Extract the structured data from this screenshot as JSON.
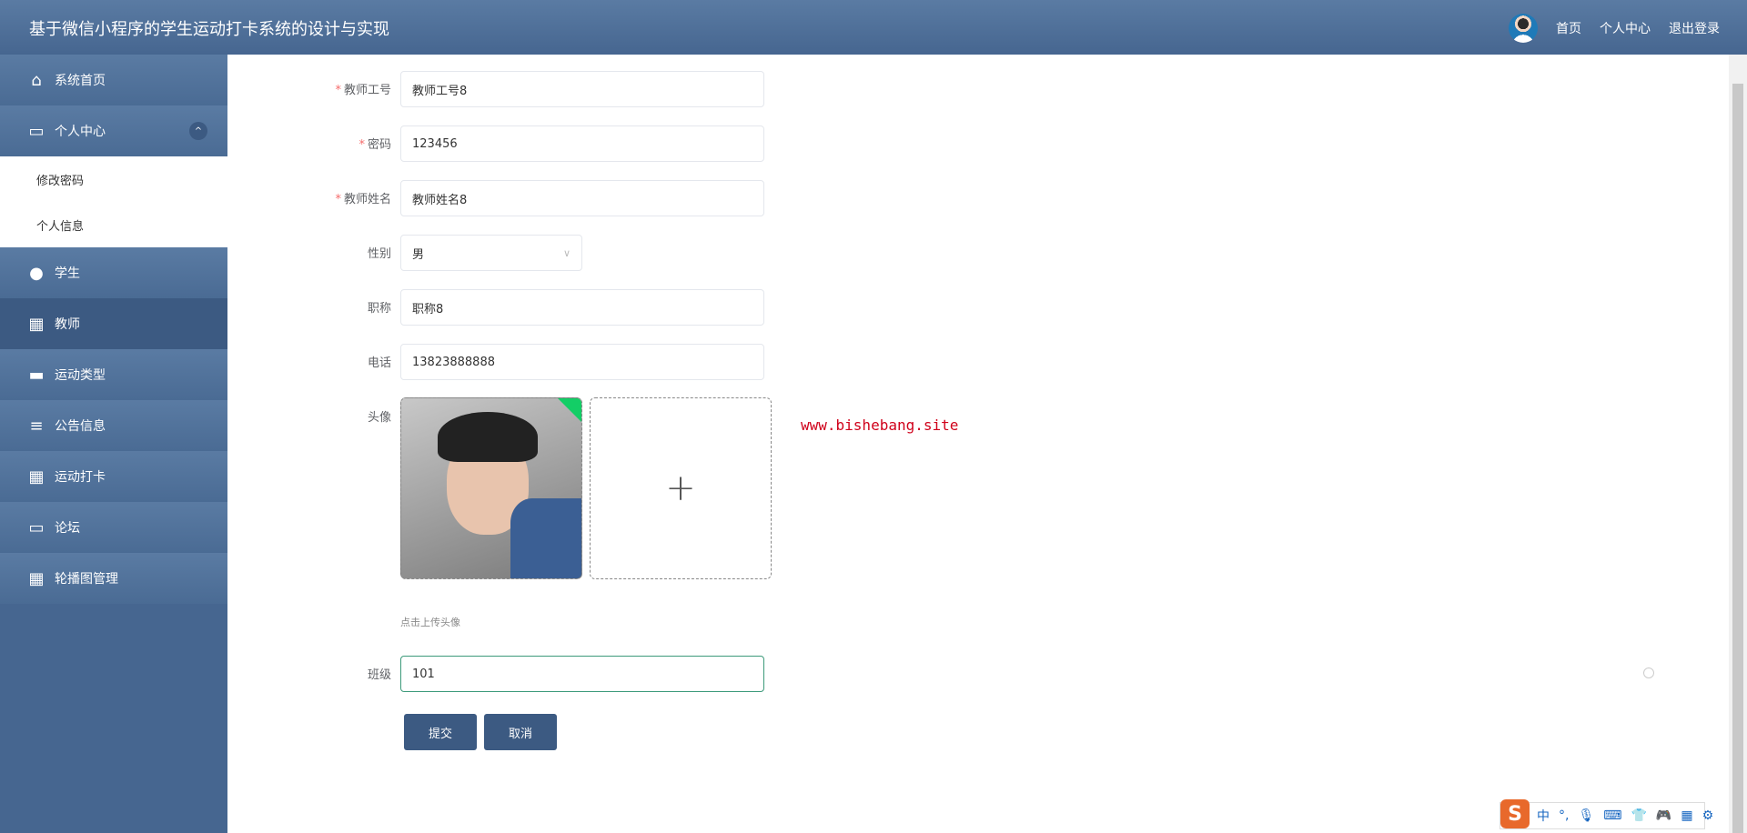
{
  "header": {
    "title": "基于微信小程序的学生运动打卡系统的设计与实现",
    "nav": [
      "首页",
      "个人中心",
      "退出登录"
    ]
  },
  "sidebar": {
    "items": [
      {
        "label": "系统首页",
        "icon": "home-icon"
      },
      {
        "label": "个人中心",
        "icon": "card-icon",
        "sub": [
          "修改密码",
          "个人信息"
        ]
      },
      {
        "label": "学生",
        "icon": "user-icon"
      },
      {
        "label": "教师",
        "icon": "grid-icon"
      },
      {
        "label": "运动类型",
        "icon": "ticket-icon"
      },
      {
        "label": "公告信息",
        "icon": "sliders-icon"
      },
      {
        "label": "运动打卡",
        "icon": "grid-icon"
      },
      {
        "label": "论坛",
        "icon": "monitor-icon"
      },
      {
        "label": "轮播图管理",
        "icon": "grid-icon"
      }
    ]
  },
  "form": {
    "teacher_id": {
      "label": "教师工号",
      "value": "教师工号8"
    },
    "password": {
      "label": "密码",
      "value": "123456"
    },
    "teacher_name": {
      "label": "教师姓名",
      "value": "教师姓名8"
    },
    "gender": {
      "label": "性别",
      "value": "男"
    },
    "title": {
      "label": "职称",
      "value": "职称8"
    },
    "phone": {
      "label": "电话",
      "value": "13823888888"
    },
    "avatar": {
      "label": "头像",
      "hint": "点击上传头像"
    },
    "class": {
      "label": "班级",
      "value": "101"
    },
    "submit": "提交",
    "cancel": "取消",
    "required_mark": "*"
  },
  "watermark": "www.bishebang.site",
  "ime": {
    "logo": "S",
    "mode": "中",
    "punct": "°,"
  }
}
